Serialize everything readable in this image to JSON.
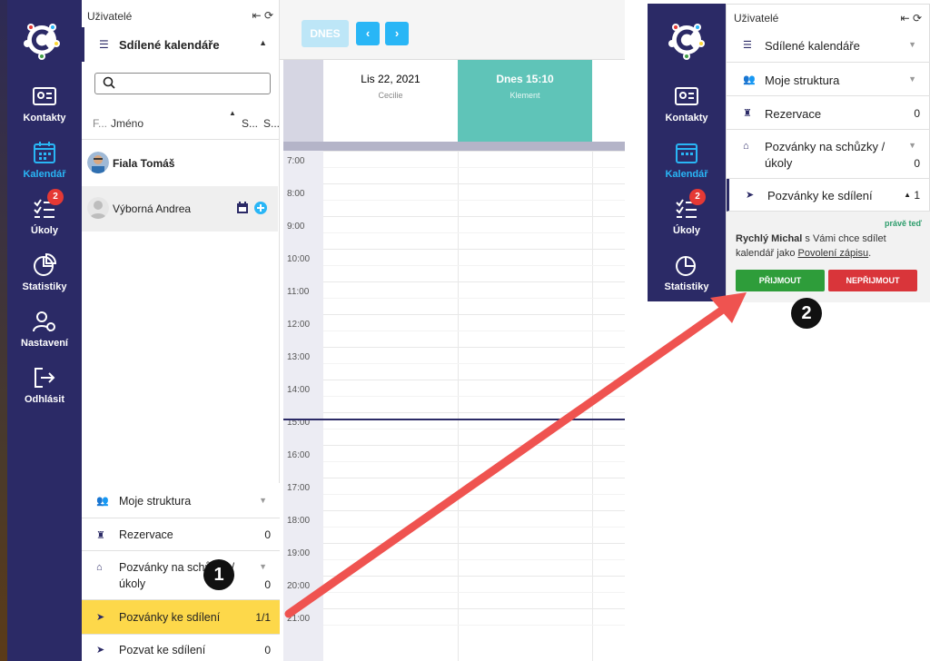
{
  "nav": {
    "items": [
      {
        "label": "Kontakty",
        "icon": "contact-card-icon"
      },
      {
        "label": "Kalendář",
        "icon": "calendar-icon",
        "active": true
      },
      {
        "label": "Úkoly",
        "icon": "checklist-icon",
        "badge": "2"
      },
      {
        "label": "Statistiky",
        "icon": "pie-chart-icon"
      },
      {
        "label": "Nastavení",
        "icon": "user-gear-icon"
      },
      {
        "label": "Odhlásit",
        "icon": "logout-icon"
      }
    ]
  },
  "panel": {
    "header": "Uživatelé",
    "shared_calendars": "Sdílené kalendáře",
    "columns": {
      "f": "F...",
      "name": "Jméno",
      "s1": "S...",
      "s2": "S..."
    },
    "users": [
      {
        "name": "Fiala Tomáš"
      },
      {
        "name": "Výborná Andrea"
      }
    ],
    "sections": [
      {
        "label": "Moje struktura",
        "count": ""
      },
      {
        "label": "Rezervace",
        "count": "0"
      },
      {
        "label": "Pozvánky na schůzky / úkoly",
        "line1": "Pozvánky na schůzky /",
        "line2": "úkoly",
        "count": "0"
      },
      {
        "label": "Pozvánky ke sdílení",
        "count": "1/1"
      },
      {
        "label": "Pozvat ke sdílení",
        "count": "0"
      }
    ]
  },
  "calendar": {
    "today_button": "DNES",
    "prev": "‹",
    "next": "›",
    "days": [
      {
        "date": "Lis 22, 2021",
        "owner": "Cecilie"
      },
      {
        "date": "Dnes 15:10",
        "owner": "Klement"
      }
    ],
    "hours": [
      "7:00",
      "8:00",
      "9:00",
      "10:00",
      "11:00",
      "12:00",
      "13:00",
      "14:00",
      "15:00",
      "16:00",
      "17:00",
      "18:00",
      "19:00",
      "20:00",
      "21:00"
    ]
  },
  "zoom": {
    "header": "Uživatelé",
    "rows": [
      {
        "label": "Sdílené kalendáře",
        "count": ""
      },
      {
        "label": "Moje struktura",
        "count": ""
      },
      {
        "label": "Rezervace",
        "count": "0"
      },
      {
        "label": "Pozvánky na schůzky / úkoly",
        "line1": "Pozvánky na schůzky /",
        "line2": "úkoly",
        "count": "0"
      },
      {
        "label": "Pozvánky ke sdílení",
        "count": "1"
      }
    ],
    "invite": {
      "time": "právě teď",
      "sender": "Rychlý Michal",
      "text_mid": " s Vámi chce sdílet kalendář jako ",
      "permission": "Povolení zápisu",
      "text_end": ".",
      "accept": "PŘIJMOUT",
      "reject": "NEPŘIJMOUT"
    },
    "nav": [
      "Kontakty",
      "Kalendář",
      "Úkoly",
      "Statistiky"
    ],
    "badge": "2"
  },
  "markers": [
    "1",
    "2"
  ],
  "colors": {
    "nav_bg": "#2b2a66",
    "active": "#29b6f6",
    "today_col": "#5fc4b8",
    "highlight": "#ffd740",
    "arrow": "#ef5350",
    "accept": "#2e9d3a",
    "reject": "#d9353a"
  }
}
